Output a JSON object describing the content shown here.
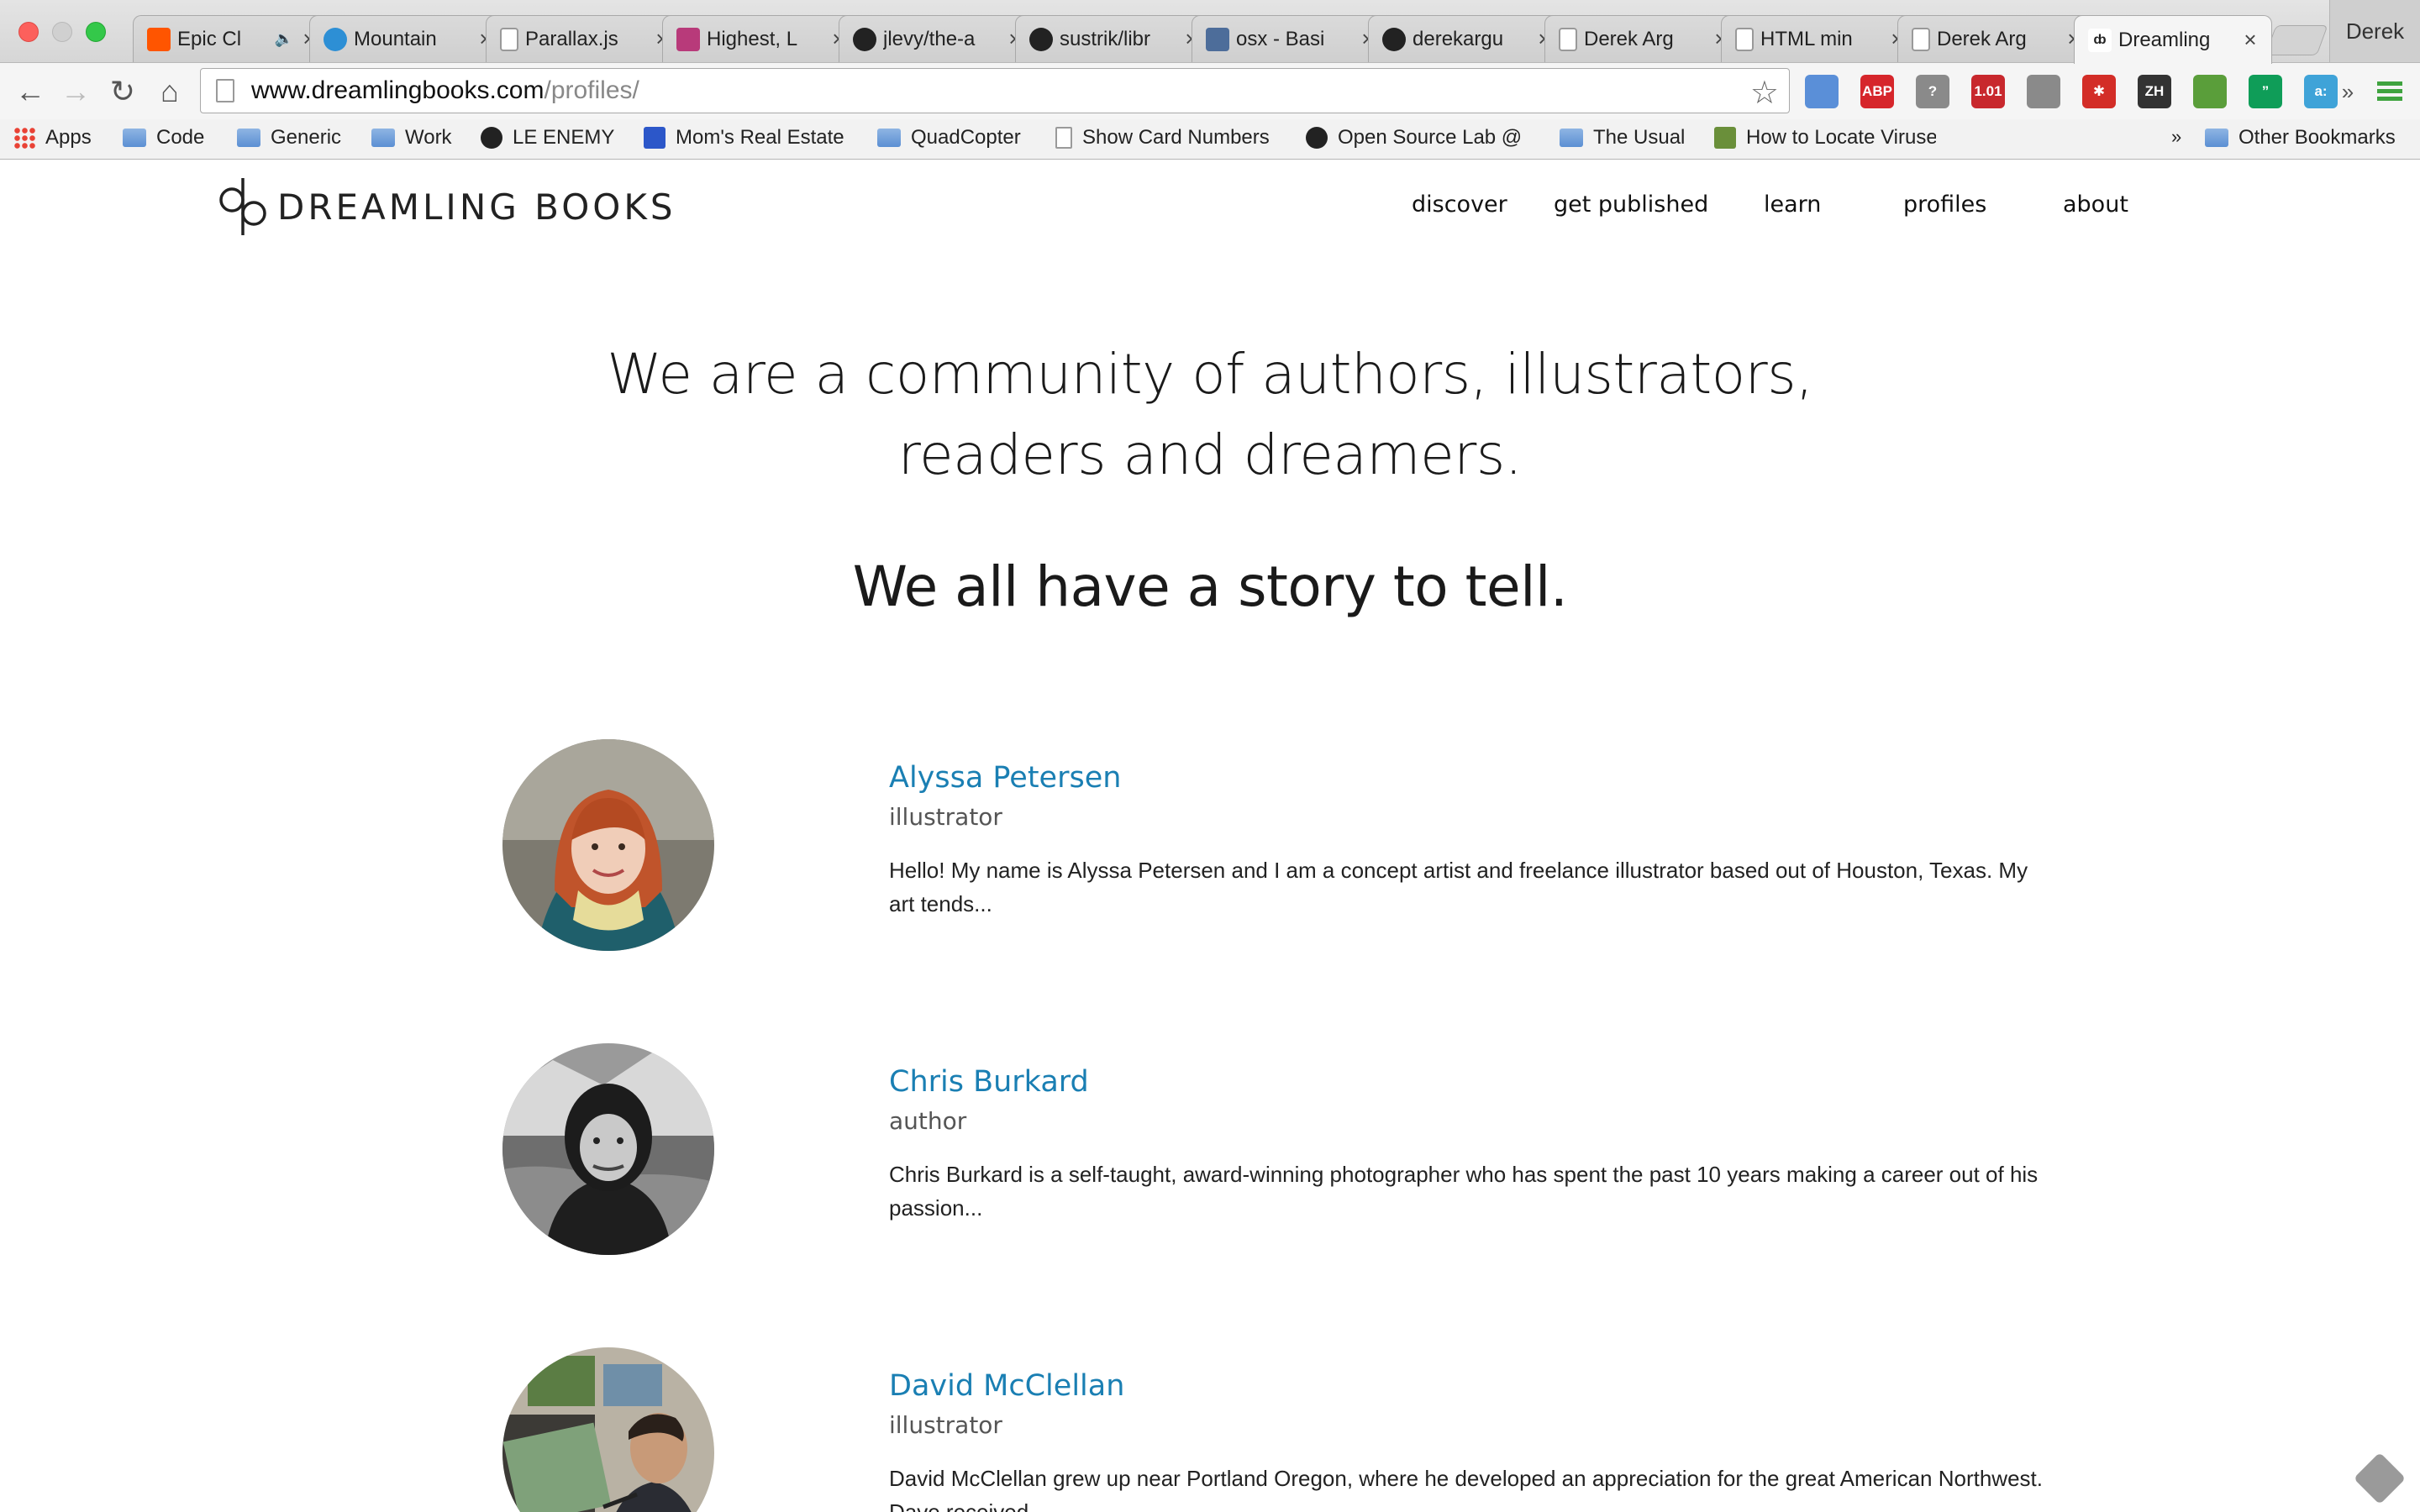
{
  "browser": {
    "profile_name": "Derek",
    "tabs": [
      {
        "title": "Epic Cl",
        "favicon": "soundcloud-icon",
        "favicon_color": "#ff5500",
        "extra": "🔈"
      },
      {
        "title": "Mountain",
        "favicon": "globe-icon",
        "favicon_color": "#2d8fd5",
        "extra": ""
      },
      {
        "title": "Parallax.js",
        "favicon": "page-icon",
        "favicon_color": "#ffffff",
        "extra": ""
      },
      {
        "title": "Highest, L",
        "favicon": "image-icon",
        "favicon_color": "#b83a7a",
        "extra": ""
      },
      {
        "title": "jlevy/the-a",
        "favicon": "github-icon",
        "favicon_color": "#222222",
        "extra": ""
      },
      {
        "title": "sustrik/libr",
        "favicon": "github-icon",
        "favicon_color": "#222222",
        "extra": ""
      },
      {
        "title": "osx - Basi",
        "favicon": "unix-icon",
        "favicon_color": "#4d6d9a",
        "extra": ""
      },
      {
        "title": "derekargu",
        "favicon": "github-icon",
        "favicon_color": "#222222",
        "extra": ""
      },
      {
        "title": "Derek Arg",
        "favicon": "page-icon",
        "favicon_color": "#ffffff",
        "extra": ""
      },
      {
        "title": "HTML min",
        "favicon": "page-icon",
        "favicon_color": "#ffffff",
        "extra": ""
      },
      {
        "title": "Derek Arg",
        "favicon": "page-icon",
        "favicon_color": "#ffffff",
        "extra": ""
      },
      {
        "title": "Dreamling",
        "favicon": "dreamling-icon",
        "favicon_color": "#ffffff",
        "extra": ""
      }
    ],
    "url_host": "www.dreamlingbooks.com",
    "url_path": "/profiles/",
    "extensions": [
      {
        "name": "window-icon",
        "label": "",
        "color": "#5a8fd8"
      },
      {
        "name": "adblock-icon",
        "label": "ABP",
        "color": "#d6262b"
      },
      {
        "name": "question-icon",
        "label": "?",
        "color": "#8a8a8a"
      },
      {
        "name": "speed-icon",
        "label": "1.01",
        "color": "#c8282d"
      },
      {
        "name": "handshake-icon",
        "label": "",
        "color": "#8a8a8a"
      },
      {
        "name": "lastpass-icon",
        "label": "✱",
        "color": "#d32d27"
      },
      {
        "name": "zenhub-icon",
        "label": "ZH",
        "color": "#333333"
      },
      {
        "name": "evernote-icon",
        "label": "",
        "color": "#5a9e3a"
      },
      {
        "name": "hangouts-icon",
        "label": "”",
        "color": "#0f9d58"
      },
      {
        "name": "amazon-assistant-icon",
        "label": "a:",
        "color": "#3fa3d8"
      }
    ],
    "bookmarks": [
      {
        "label": "Apps",
        "icon": "apps-icon"
      },
      {
        "label": "Code",
        "icon": "folder-icon"
      },
      {
        "label": "Generic",
        "icon": "folder-icon"
      },
      {
        "label": "Work",
        "icon": "folder-icon"
      },
      {
        "label": "LE ENEMY",
        "icon": "github-icon"
      },
      {
        "label": "Mom's Real Estate",
        "icon": "realestate-icon"
      },
      {
        "label": "QuadCopter",
        "icon": "folder-icon"
      },
      {
        "label": "Show Card Numbers",
        "icon": "page-icon"
      },
      {
        "label": "Open Source Lab @",
        "icon": "github-icon"
      },
      {
        "label": "The Usual",
        "icon": "folder-icon"
      },
      {
        "label": "How to Locate Viruse",
        "icon": "wikihow-icon"
      }
    ],
    "bookmarks_overflow": "»",
    "other_bookmarks": "Other Bookmarks"
  },
  "site": {
    "logo_text": "DREAMLING BOOKS",
    "nav": [
      {
        "label": "discover"
      },
      {
        "label": "get published"
      },
      {
        "label": "learn"
      },
      {
        "label": "profiles"
      },
      {
        "label": "about"
      }
    ],
    "hero_line1": "We are a community of authors, illustrators, readers and dreamers.",
    "hero_line2": "We all have a story to tell.",
    "profiles": [
      {
        "name": "Alyssa Petersen",
        "role": "illustrator",
        "bio": "Hello! My name is Alyssa Petersen and I am a concept artist and freelance illustrator based out of Houston, Texas. My art tends..."
      },
      {
        "name": "Chris Burkard",
        "role": "author",
        "bio": "Chris Burkard is a self-taught, award-winning photographer who has spent the past 10 years making a career out of his passion..."
      },
      {
        "name": "David McClellan",
        "role": "illustrator",
        "bio": "David McClellan grew up near Portland Oregon, where he developed an appreciation for the great American Northwest. Dave received..."
      }
    ]
  }
}
